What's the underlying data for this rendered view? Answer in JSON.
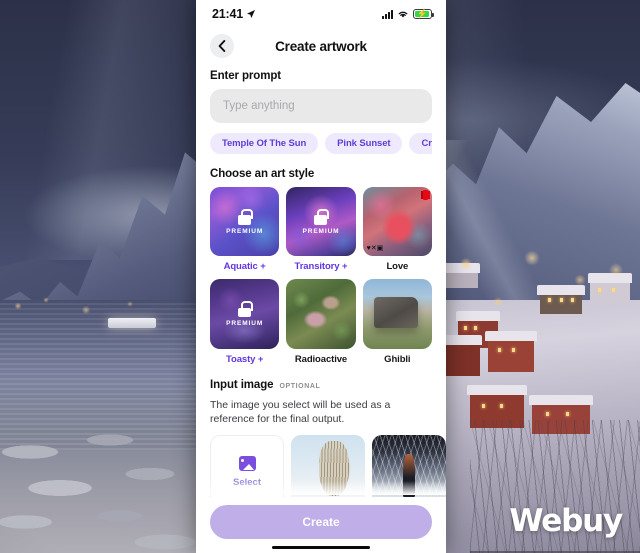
{
  "background": {
    "scene_description": "Snowy fjord village at dusk",
    "watermark": "Webuy"
  },
  "phone": {
    "status_bar": {
      "time": "21:41",
      "location_icon": "location-arrow-icon",
      "signal_icon": "cellular-signal-icon",
      "wifi_icon": "wifi-icon",
      "battery_icon": "battery-charging-icon"
    },
    "nav": {
      "back_icon": "chevron-left-icon",
      "title": "Create artwork"
    },
    "prompt": {
      "section_label": "Enter prompt",
      "placeholder": "Type anything",
      "value": ""
    },
    "chips": [
      {
        "label": "Temple Of The Sun"
      },
      {
        "label": "Pink Sunset"
      },
      {
        "label": "Crowded"
      }
    ],
    "styles": {
      "section_label": "Choose an art style",
      "premium_badge": "PREMIUM",
      "lock_icon": "lock-icon",
      "items": [
        {
          "name": "Aquatic +",
          "premium": true,
          "art": "art-aquatic",
          "badge": ""
        },
        {
          "name": "Transitory +",
          "premium": true,
          "art": "art-transitory",
          "badge": ""
        },
        {
          "name": "Love",
          "premium": false,
          "art": "art-love",
          "badge": "netflix-badge"
        },
        {
          "name": "Toasty +",
          "premium": true,
          "art": "art-toasty",
          "badge": ""
        },
        {
          "name": "Radioactive",
          "premium": false,
          "art": "art-radio",
          "badge": ""
        },
        {
          "name": "Ghibli",
          "premium": false,
          "art": "art-ghibli",
          "badge": ""
        }
      ]
    },
    "input_image": {
      "section_label": "Input image",
      "optional_tag": "OPTIONAL",
      "helper_text": "The image you select will be used as a reference for the final output.",
      "select_card": {
        "icon": "picture-icon",
        "label": "Select"
      },
      "thumbnails": [
        {
          "name": "owl-photo"
        },
        {
          "name": "corridor-photo"
        }
      ]
    },
    "footer": {
      "create_label": "Create",
      "home_indicator": "home-indicator"
    }
  },
  "colors": {
    "accent_purple": "#6336e0",
    "chip_bg": "#efe9fd",
    "chip_text": "#5b3fd6",
    "create_button": "#c0aee8",
    "field_bg": "#e9e9ea",
    "battery_green": "#32d74b"
  }
}
